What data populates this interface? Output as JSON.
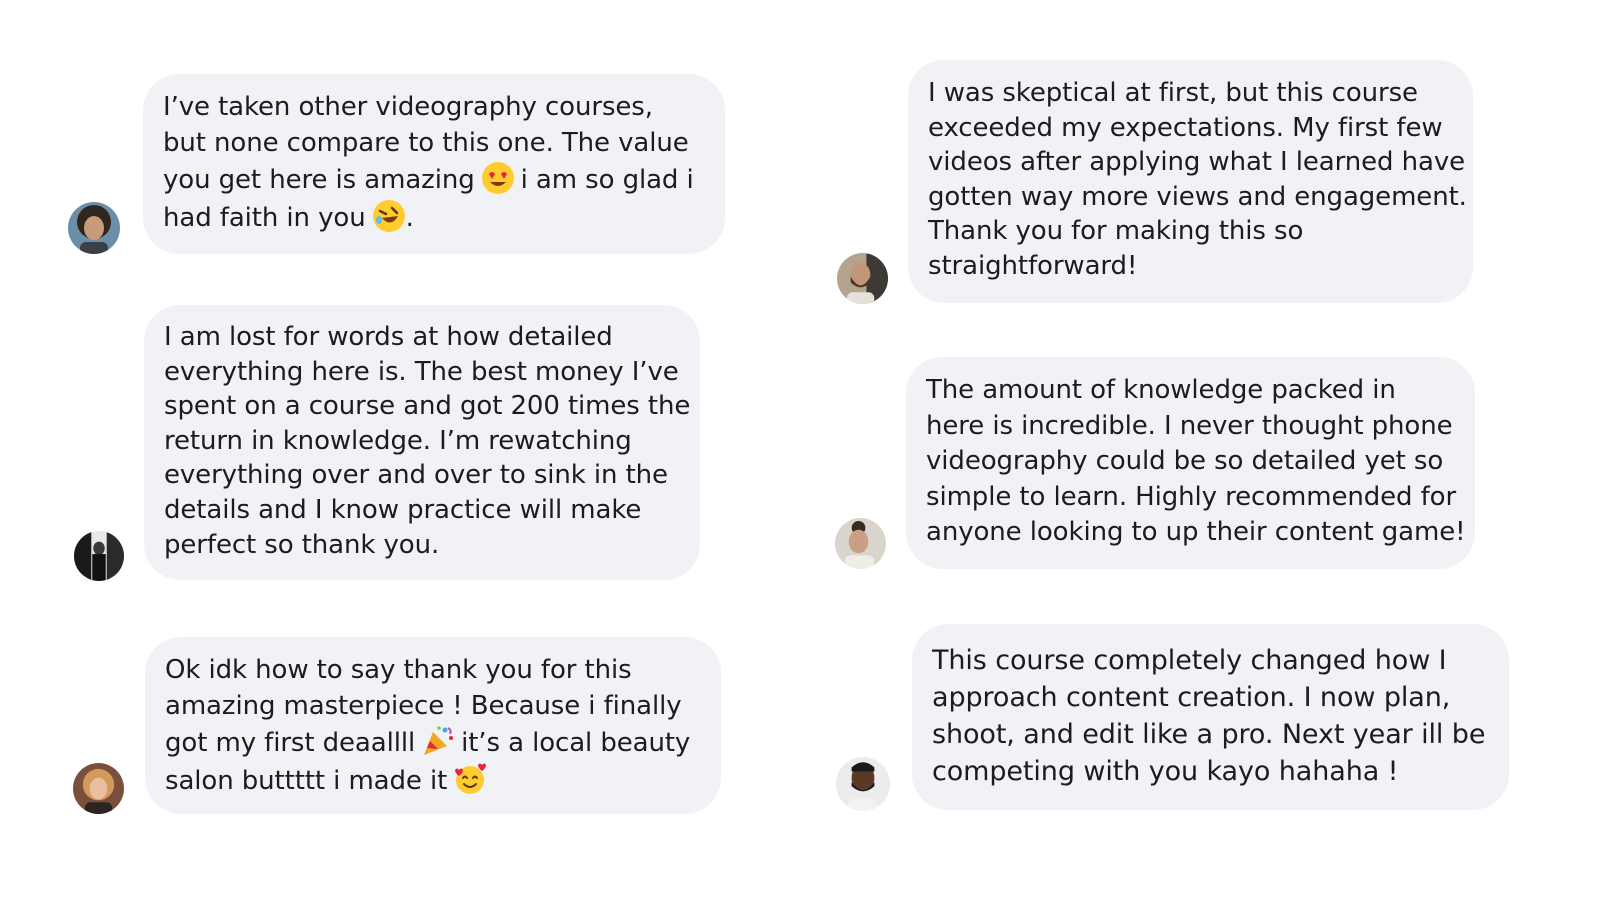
{
  "messages": [
    {
      "id": "left-1",
      "avatar_icon": "avatar-curly-hair-icon",
      "lines": [
        "I’ve taken other videography courses,",
        "but none compare to this one. The value",
        "you get here is amazing",
        "i am so glad i",
        "had faith in you",
        "."
      ],
      "emojis": [
        "heart-eyes-emoji-icon",
        "rolling-laughing-emoji-icon"
      ]
    },
    {
      "id": "left-2",
      "avatar_icon": "avatar-mirror-selfie-icon",
      "lines": [
        "I am lost for words at how detailed",
        "everything here is. The best money I’ve",
        "spent on a course and got 200 times the",
        "return in knowledge. I’m rewatching",
        "everything over and over to sink in the",
        "details and I know practice will make",
        "perfect so thank you."
      ]
    },
    {
      "id": "left-3",
      "avatar_icon": "avatar-blonde-woman-icon",
      "lines": [
        "Ok idk how to say thank you for this",
        "amazing masterpiece ! Because i finally",
        "got my first deaallll",
        "it’s a local beauty",
        "salon buttttt i made it"
      ],
      "emojis": [
        "party-popper-emoji-icon",
        "smiling-hearts-emoji-icon"
      ]
    },
    {
      "id": "right-1",
      "avatar_icon": "avatar-bearded-man-icon",
      "lines": [
        "I was skeptical at first, but this course",
        "exceeded my expectations. My first few",
        "videos after applying what I learned have",
        "gotten way more views and engagement.",
        "Thank you for making this so",
        "straightforward!"
      ]
    },
    {
      "id": "right-2",
      "avatar_icon": "avatar-woman-bun-icon",
      "lines": [
        "The amount of knowledge packed in",
        "here is incredible. I never thought phone",
        "videography could be so detailed yet so",
        "simple to learn. Highly recommended for",
        "anyone looking to up their content game!"
      ]
    },
    {
      "id": "right-3",
      "avatar_icon": "avatar-man-beard-icon",
      "lines": [
        "This course completely changed how I",
        "approach content creation. I now plan,",
        "shoot, and edit like a pro. Next year ill be",
        "competing with you kayo hahaha !"
      ]
    }
  ],
  "colors": {
    "bubble_bg": "#f1f2f5",
    "text": "#1c1c1e",
    "page_bg": "#ffffff"
  }
}
